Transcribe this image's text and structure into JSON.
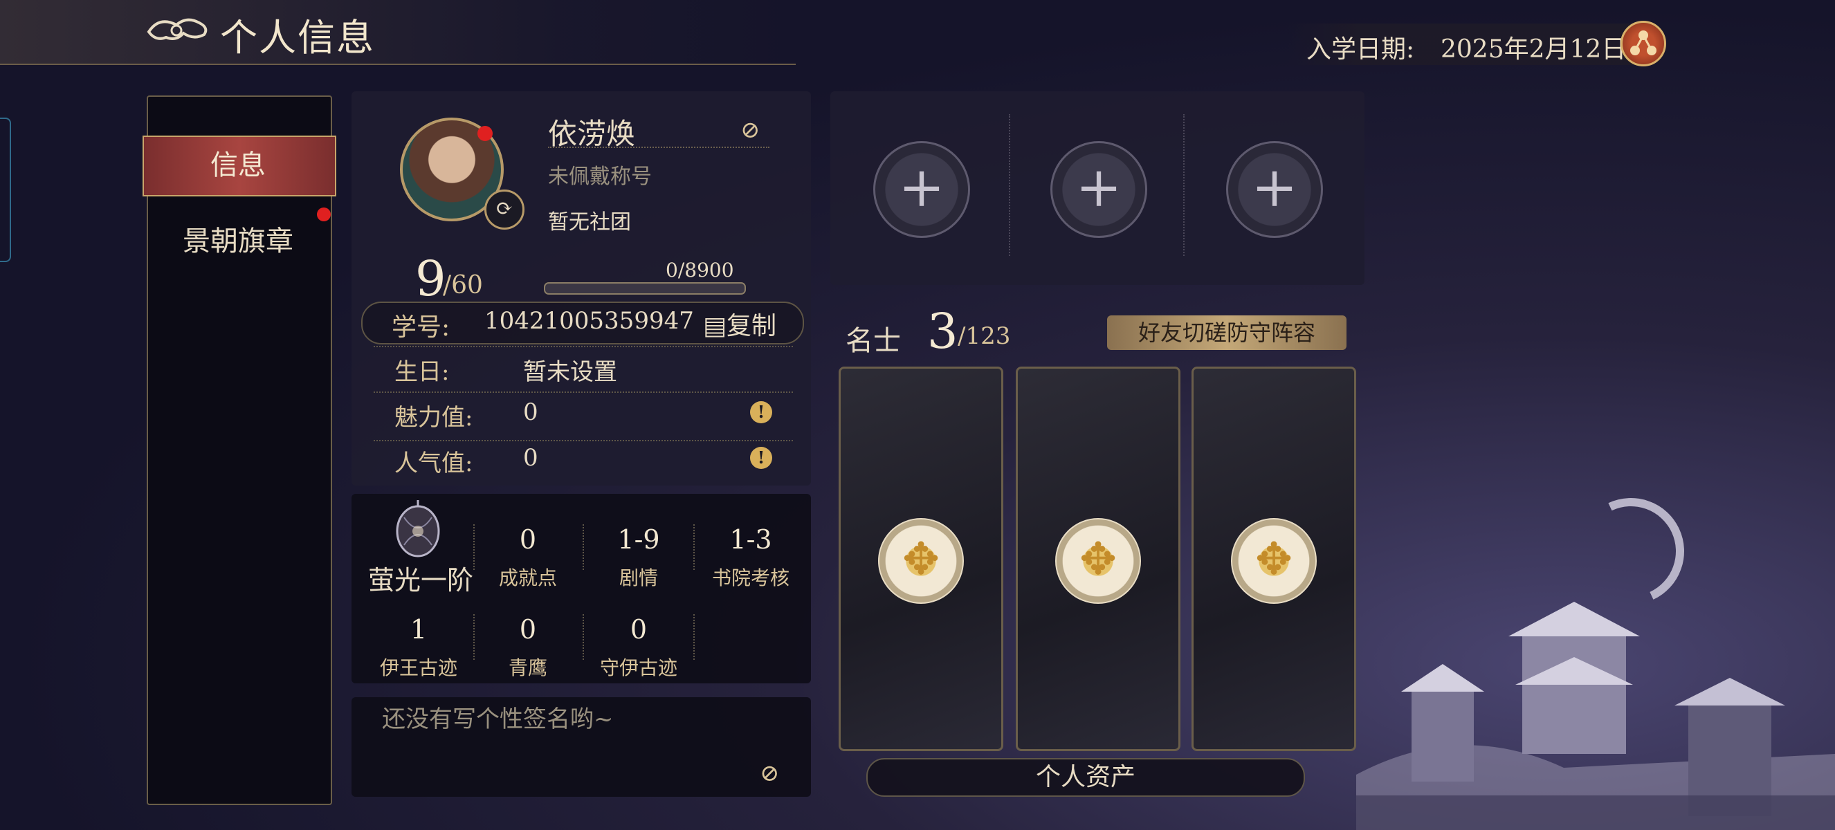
{
  "header": {
    "title": "个人信息",
    "enroll_label": "入学日期:",
    "enroll_date": "2025年2月12日"
  },
  "nav": {
    "items": [
      {
        "label": "信息",
        "active": true
      },
      {
        "label": "景朝旗章",
        "active": false,
        "has_notification": true
      }
    ]
  },
  "profile": {
    "name": "依涝焕",
    "title": "未佩戴称号",
    "club": "暂无社团",
    "level": "9",
    "level_max": "/60",
    "exp": "0/8900",
    "exp_progress": 0,
    "id_label": "学号:",
    "id_value": "10421005359947",
    "copy_label": "复制",
    "birthday_label": "生日:",
    "birthday_value": "暂未设置",
    "charm_label": "魅力值:",
    "charm_value": "0",
    "popularity_label": "人气值:",
    "popularity_value": "0"
  },
  "stats": {
    "rank": "萤光一阶",
    "items": [
      {
        "value": "0",
        "label": "成就点"
      },
      {
        "value": "1-9",
        "label": "剧情"
      },
      {
        "value": "1-3",
        "label": "书院考核"
      },
      {
        "value": "1",
        "label": "伊王古迹"
      },
      {
        "value": "0",
        "label": "青鹰"
      },
      {
        "value": "0",
        "label": "守伊古迹"
      }
    ]
  },
  "signature": {
    "text": "还没有写个性签名哟~"
  },
  "slots": {
    "add_glyph": "+"
  },
  "mingshi": {
    "label": "名士",
    "count": "3",
    "total": "/123",
    "defense_button": "好友切磋防守阵容"
  },
  "assets_button": "个人资产",
  "colors": {
    "accent_gold": "#d9c49a",
    "active_tab": "#a84540",
    "notification": "#e02020"
  }
}
